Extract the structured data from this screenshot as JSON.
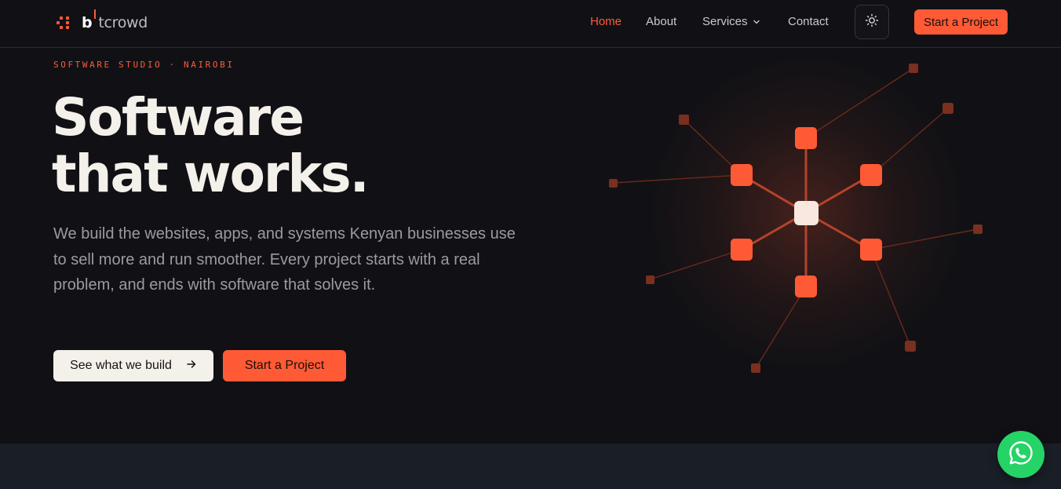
{
  "brand": {
    "logo_b": "b",
    "logo_rest": "tcrowd",
    "accent": "#ff5a36"
  },
  "nav": {
    "items": [
      {
        "label": "Home",
        "active": true
      },
      {
        "label": "About",
        "active": false
      },
      {
        "label": "Services",
        "active": false,
        "has_dropdown": true
      },
      {
        "label": "Contact",
        "active": false
      }
    ],
    "theme_toggle_icon": "sun-icon",
    "cta_label": "Start a Project"
  },
  "hero": {
    "eyebrow": "SOFTWARE STUDIO · NAIROBI",
    "headline_line1": "Software",
    "headline_line2": "that works.",
    "lede": "We build the websites, apps, and systems Kenyan businesses use to sell more and run smoother. Every project starts with a real problem, and ends with software that solves it.",
    "secondary_cta": "See what we build",
    "secondary_cta_icon": "arrow-right-icon",
    "primary_cta": "Start a Project"
  },
  "floating": {
    "whatsapp_icon": "whatsapp-icon",
    "whatsapp_color": "#25d366"
  }
}
